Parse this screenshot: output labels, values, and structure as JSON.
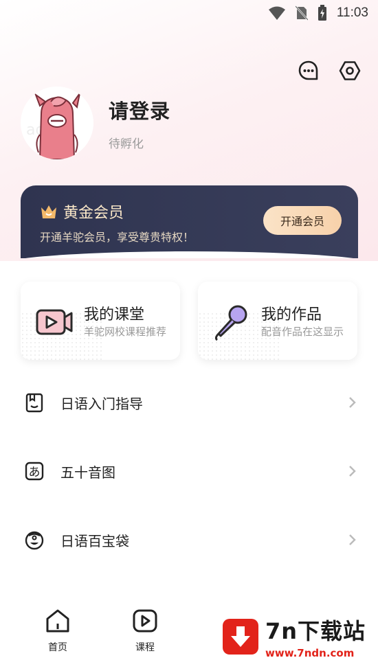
{
  "status_bar": {
    "time": "11:03"
  },
  "top_actions": {
    "message_icon": "chat-bubble-icon",
    "settings_icon": "hex-settings-icon"
  },
  "profile": {
    "title": "请登录",
    "subtitle": "待孵化"
  },
  "vip": {
    "title": "黄金会员",
    "subtitle": "开通羊驼会员，享受尊贵特权！",
    "button": "开通会员"
  },
  "cards": [
    {
      "title": "我的课堂",
      "subtitle": "羊驼网校课程推荐"
    },
    {
      "title": "我的作品",
      "subtitle": "配音作品在这显示"
    }
  ],
  "menu": [
    {
      "label": "日语入门指导"
    },
    {
      "label": "五十音图"
    },
    {
      "label": "日语百宝袋"
    }
  ],
  "tabs": [
    {
      "label": "首页"
    },
    {
      "label": "课程"
    }
  ],
  "watermark": {
    "name": "7n下载站",
    "url": "www.7ndn.com"
  },
  "colors": {
    "vip_bg": "#2f3450",
    "accent": "#e2231a",
    "brand_pink": "#e97f8b"
  }
}
